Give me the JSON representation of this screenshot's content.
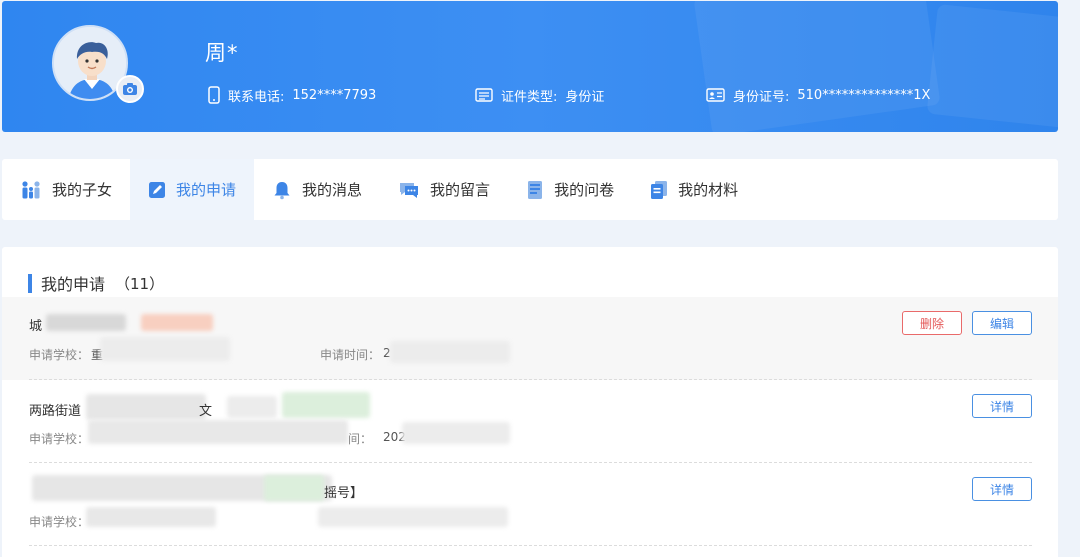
{
  "profile": {
    "name": "周*",
    "phone_label": "联系电话:",
    "phone_value": "152****7793",
    "id_type_label": "证件类型:",
    "id_type_value": "身份证",
    "id_no_label": "身份证号:",
    "id_no_value": "510**************1X"
  },
  "tabs": [
    {
      "label": "我的子女",
      "icon": "family-icon"
    },
    {
      "label": "我的申请",
      "icon": "edit-note-icon",
      "active": true
    },
    {
      "label": "我的消息",
      "icon": "bell-icon"
    },
    {
      "label": "我的留言",
      "icon": "chat-icon"
    },
    {
      "label": "我的问卷",
      "icon": "questionnaire-icon"
    },
    {
      "label": "我的材料",
      "icon": "documents-icon"
    }
  ],
  "applications": {
    "title": "我的申请",
    "count": "（11）",
    "rows": [
      {
        "title": "城",
        "school_label": "申请学校：",
        "school_value": "重",
        "time_label": "申请时间：",
        "time_value": "2",
        "buttons": [
          "删除",
          "编辑"
        ]
      },
      {
        "title": "两路街道",
        "title_suffix": "文",
        "school_label": "申请学校：",
        "school_value": "",
        "time_label": "间：",
        "time_value": "202",
        "buttons": [
          "详情"
        ]
      },
      {
        "title": "",
        "title_tag": "摇号】",
        "school_label": "申请学校：",
        "school_value": "",
        "buttons": [
          "详情"
        ]
      }
    ]
  },
  "colors": {
    "header_blue": "#3d8ff3",
    "accent": "#3d85e6",
    "danger": "#e45858",
    "tag_green": "#3aa155"
  }
}
